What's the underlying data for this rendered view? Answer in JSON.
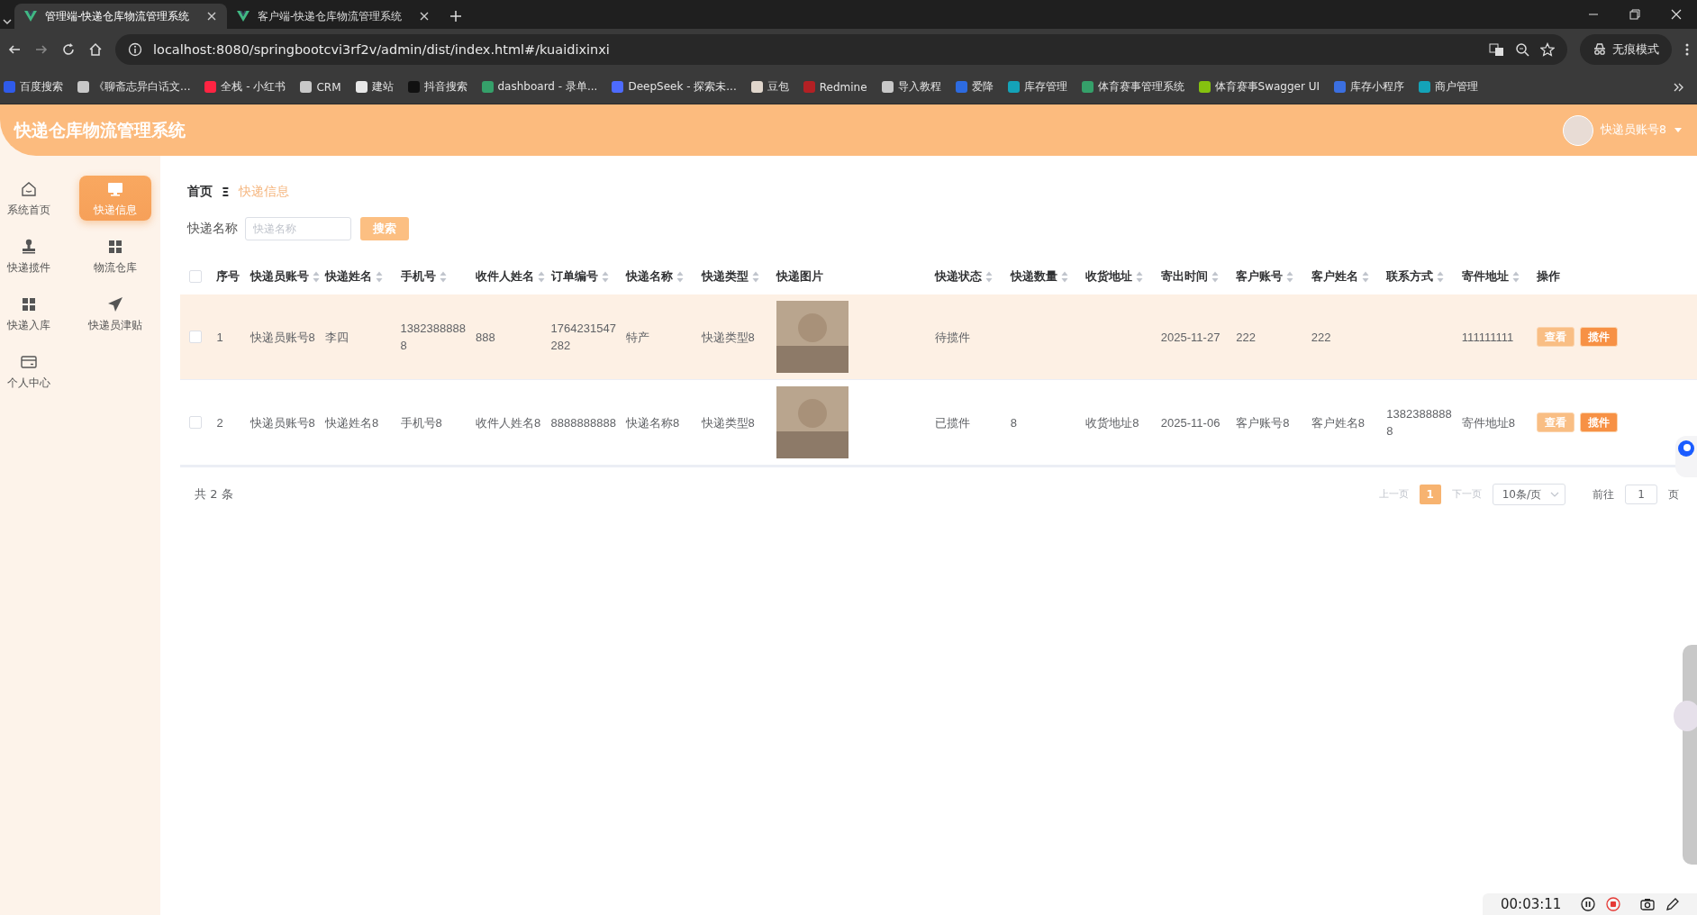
{
  "browser": {
    "tabs": [
      {
        "title": "管理端-快递仓库物流管理系统",
        "selected": true
      },
      {
        "title": "客户端-快递仓库物流管理系统",
        "selected": false
      }
    ],
    "url": "localhost:8080/springbootcvi3rf2v/admin/dist/index.html#/kuaidixinxi",
    "incognito_label": "无痕模式",
    "bookmarks": [
      {
        "label": "百度搜索",
        "color": "#2f5bea"
      },
      {
        "label": "《聊斋志异白话文...",
        "color": "#c8c8c8"
      },
      {
        "label": "全栈 - 小红书",
        "color": "#ff2442"
      },
      {
        "label": "CRM",
        "color": "#c8c8c8"
      },
      {
        "label": "建站",
        "color": "#e8e8e8"
      },
      {
        "label": "抖音搜索",
        "color": "#111111"
      },
      {
        "label": "dashboard - 录单...",
        "color": "#35a06a"
      },
      {
        "label": "DeepSeek - 探索未...",
        "color": "#4d6bfe"
      },
      {
        "label": "豆包",
        "color": "#e0d6cc"
      },
      {
        "label": "Redmine",
        "color": "#b32024"
      },
      {
        "label": "导入教程",
        "color": "#c8c8c8"
      },
      {
        "label": "爱降",
        "color": "#2d6be0"
      },
      {
        "label": "库存管理",
        "color": "#14a3b8"
      },
      {
        "label": "体育赛事管理系统",
        "color": "#35a06a"
      },
      {
        "label": "体育赛事Swagger UI",
        "color": "#85c20f"
      },
      {
        "label": "库存小程序",
        "color": "#3b6fe0"
      },
      {
        "label": "商户管理",
        "color": "#14a3b8"
      }
    ]
  },
  "header": {
    "title": "快递仓库物流管理系统",
    "user": "快递员账号8"
  },
  "sidebar": {
    "items": [
      {
        "label": "系统首页",
        "selected": false
      },
      {
        "label": "快递信息",
        "selected": true
      },
      {
        "label": "快递揽件",
        "selected": false
      },
      {
        "label": "物流仓库",
        "selected": false
      },
      {
        "label": "快递入库",
        "selected": false
      },
      {
        "label": "快递员津贴",
        "selected": false
      },
      {
        "label": "个人中心",
        "selected": false
      }
    ]
  },
  "breadcrumb": {
    "home": "首页",
    "separator": "Ξ",
    "current": "快递信息"
  },
  "search": {
    "label": "快递名称",
    "placeholder": "快递名称",
    "button": "搜索"
  },
  "table": {
    "header_checked": false,
    "columns": [
      {
        "label": "序号",
        "sortable": false
      },
      {
        "label": "快递员账号",
        "sortable": true
      },
      {
        "label": "快递姓名",
        "sortable": true
      },
      {
        "label": "手机号",
        "sortable": true
      },
      {
        "label": "收件人姓名",
        "sortable": true
      },
      {
        "label": "订单编号",
        "sortable": true
      },
      {
        "label": "快递名称",
        "sortable": true
      },
      {
        "label": "快递类型",
        "sortable": true
      },
      {
        "label": "快递图片",
        "sortable": false
      },
      {
        "label": "快递状态",
        "sortable": true
      },
      {
        "label": "快递数量",
        "sortable": true
      },
      {
        "label": "收货地址",
        "sortable": true
      },
      {
        "label": "寄出时间",
        "sortable": true
      },
      {
        "label": "客户账号",
        "sortable": true
      },
      {
        "label": "客户姓名",
        "sortable": true
      },
      {
        "label": "联系方式",
        "sortable": true
      },
      {
        "label": "寄件地址",
        "sortable": true
      },
      {
        "label": "操作",
        "sortable": false
      }
    ],
    "rows": [
      {
        "checked": false,
        "hovered": true,
        "cells": [
          {
            "kind": "text",
            "text": "1"
          },
          {
            "kind": "text",
            "text": "快递员账号8"
          },
          {
            "kind": "text",
            "text": "李四"
          },
          {
            "kind": "text",
            "text": "13823888888"
          },
          {
            "kind": "text",
            "text": "888"
          },
          {
            "kind": "text",
            "text": "1764231547282"
          },
          {
            "kind": "text",
            "text": "特产"
          },
          {
            "kind": "text",
            "text": "快递类型8"
          },
          {
            "kind": "photo"
          },
          {
            "kind": "text",
            "text": "待揽件"
          },
          {
            "kind": "blank"
          },
          {
            "kind": "blank"
          },
          {
            "kind": "text",
            "text": "2025-11-27"
          },
          {
            "kind": "text",
            "text": "222"
          },
          {
            "kind": "text",
            "text": "222"
          },
          {
            "kind": "blank"
          },
          {
            "kind": "text",
            "text": "111111111"
          }
        ],
        "actions": [
          {
            "label": "查看",
            "kind": "view"
          },
          {
            "label": "揽件",
            "kind": "collect"
          }
        ]
      },
      {
        "checked": false,
        "hovered": false,
        "cells": [
          {
            "kind": "text",
            "text": "2"
          },
          {
            "kind": "text",
            "text": "快递员账号8"
          },
          {
            "kind": "text",
            "text": "快递姓名8"
          },
          {
            "kind": "text",
            "text": "手机号8"
          },
          {
            "kind": "text",
            "text": "收件人姓名8"
          },
          {
            "kind": "text",
            "text": "8888888888"
          },
          {
            "kind": "text",
            "text": "快递名称8"
          },
          {
            "kind": "text",
            "text": "快递类型8"
          },
          {
            "kind": "photo"
          },
          {
            "kind": "text",
            "text": "已揽件"
          },
          {
            "kind": "text",
            "text": "8"
          },
          {
            "kind": "text",
            "text": "收货地址8"
          },
          {
            "kind": "text",
            "text": "2025-11-06"
          },
          {
            "kind": "text",
            "text": "客户账号8"
          },
          {
            "kind": "text",
            "text": "客户姓名8"
          },
          {
            "kind": "text",
            "text": "13823888888"
          },
          {
            "kind": "text",
            "text": "寄件地址8"
          }
        ],
        "actions": [
          {
            "label": "查看",
            "kind": "view"
          },
          {
            "label": "揽件",
            "kind": "collect"
          }
        ]
      }
    ]
  },
  "pagination": {
    "total": "共 2 条",
    "prev": "上一页",
    "prev_disabled": true,
    "pages": [
      {
        "label": "1",
        "selected": true
      }
    ],
    "next": "下一页",
    "next_disabled": true,
    "page_size": "10条/页",
    "goto_label": "前往",
    "goto_value": "1",
    "goto_suffix": "页"
  },
  "recorder": {
    "time": "00:03:11"
  }
}
